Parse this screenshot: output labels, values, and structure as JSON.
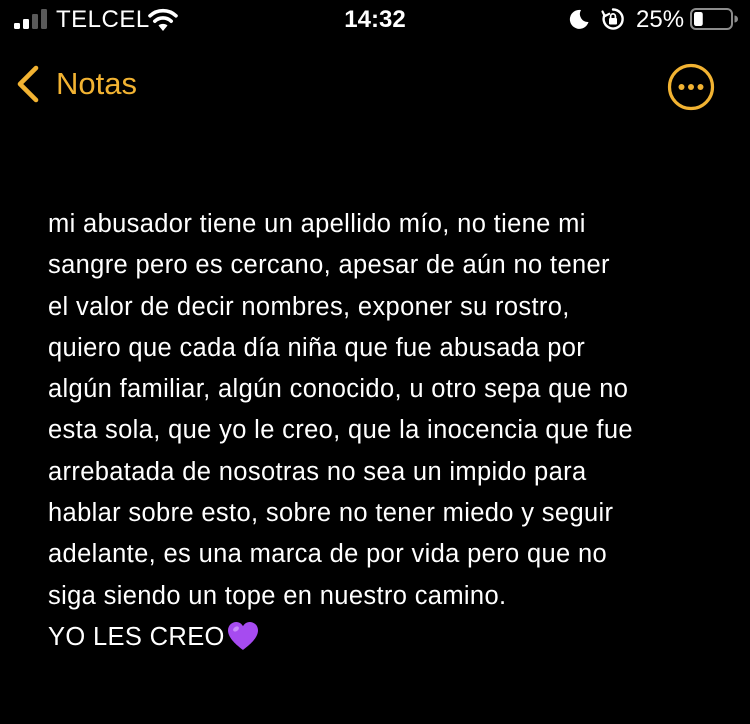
{
  "status_bar": {
    "carrier": "TELCEL",
    "time": "14:32",
    "battery_percent": "25%",
    "battery_level": 0.25,
    "icons": [
      "cellular-signal-icon",
      "wifi-icon",
      "do-not-disturb-moon-icon",
      "orientation-lock-icon",
      "battery-icon"
    ]
  },
  "nav": {
    "back_label": "Notas",
    "back_icon": "chevron-left-icon",
    "more_icon": "ellipsis-circle-icon",
    "accent_color": "#F2B332"
  },
  "note": {
    "lines": [
      "mi abusador tiene un apellido mío, no tiene mi",
      "sangre pero es cercano, apesar de aún no tener",
      "el valor de decir nombres, exponer su rostro,",
      "quiero que cada día niña que fue abusada por",
      "algún familiar, algún conocido, u otro sepa que no",
      "esta sola, que yo le creo, que la inocencia que fue",
      "arrebatada de nosotras no sea un impido para",
      "hablar sobre esto, sobre no tener miedo y seguir",
      "adelante, es una marca de por vida pero que no",
      "siga siendo un tope en nuestro camino."
    ],
    "closing": "YO LES CREO",
    "emoji": "purple-heart-icon"
  },
  "colors": {
    "background": "#000000",
    "text": "#FFFFFF",
    "accent": "#F2B332",
    "heart": "#A64BF0"
  }
}
